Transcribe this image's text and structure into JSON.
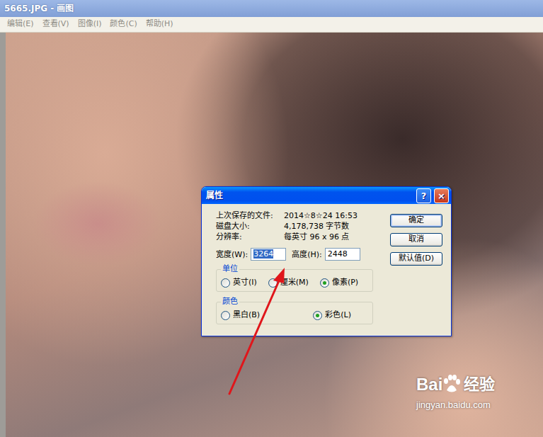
{
  "window": {
    "title": "5665.JPG - 画图"
  },
  "menu": [
    "编辑(E)",
    "查看(V)",
    "图像(I)",
    "颜色(C)",
    "帮助(H)"
  ],
  "dialog": {
    "title": "属性",
    "help": "?",
    "close": "×",
    "info": [
      {
        "label": "上次保存的文件:",
        "value": "2014☆8☆24 16:53"
      },
      {
        "label": "磁盘大小:",
        "value": "4,178,738 字节数"
      },
      {
        "label": "分辨率:",
        "value": "每英寸 96 x 96 点"
      }
    ],
    "width": {
      "label": "宽度(W):",
      "value": "3264",
      "selected": true
    },
    "height": {
      "label": "高度(H):",
      "value": "2448",
      "selected": false
    },
    "groups": [
      {
        "title": "单位",
        "options": [
          {
            "label": "英寸(I)",
            "selected": false
          },
          {
            "label": "厘米(M)",
            "selected": false
          },
          {
            "label": "像素(P)",
            "selected": true
          }
        ]
      },
      {
        "title": "颜色",
        "options": [
          {
            "label": "黑白(B)",
            "selected": false
          },
          {
            "label": "彩色(L)",
            "selected": true
          }
        ]
      }
    ],
    "buttons": [
      {
        "label": "确定",
        "default": true
      },
      {
        "label": "取消",
        "default": false
      },
      {
        "label": "默认值(D)",
        "default": false
      }
    ]
  },
  "watermark": {
    "brand": "Bai",
    "brand_cn": "经验",
    "url": "jingyan.baidu.com"
  }
}
